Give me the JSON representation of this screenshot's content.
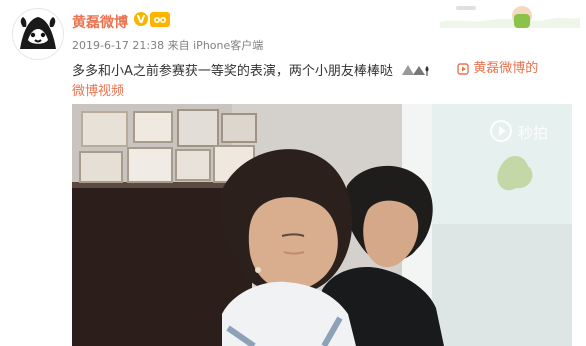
{
  "user": {
    "name": "黄磊微博"
  },
  "post": {
    "meta": {
      "date": "2019-6-17 21:38",
      "source_prefix": "来自",
      "source": "iPhone客户端"
    },
    "text": "多多和小A之前参赛获一等奖的表演，两个小朋友棒棒哒",
    "link_icon": "play-link-icon",
    "link_text": "黄磊微博的",
    "link_text_suffix": "微博视频"
  },
  "video": {
    "watermark": "秒拍"
  },
  "colors": {
    "accent": "#eb7350",
    "meta": "#808080",
    "text": "#333333"
  }
}
